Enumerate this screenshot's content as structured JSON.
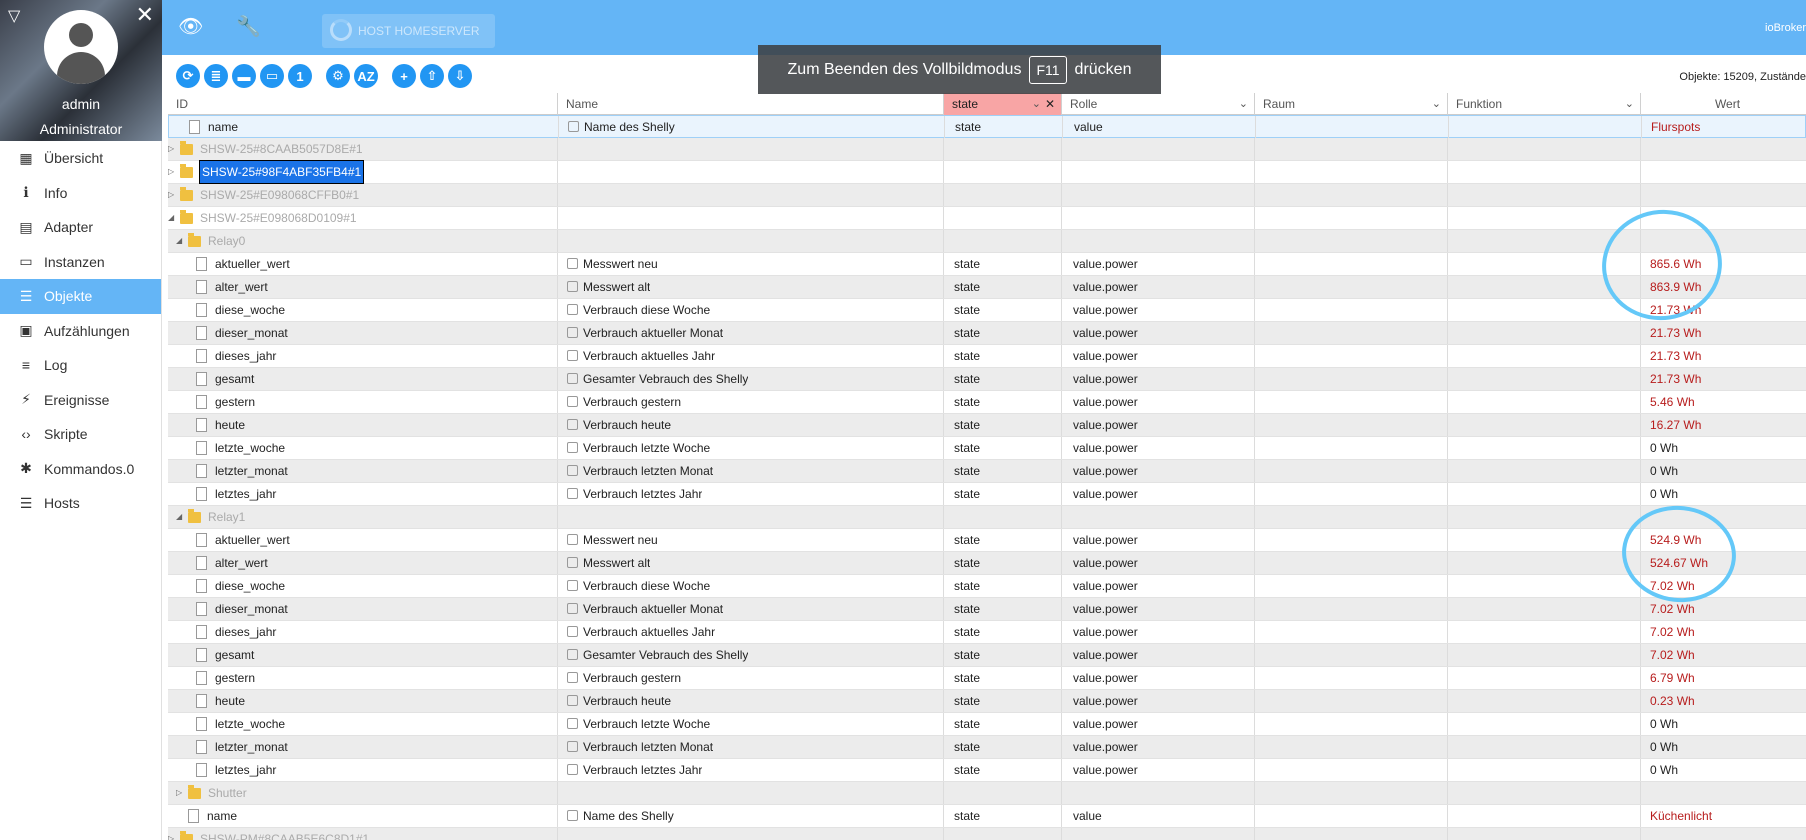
{
  "sidebar": {
    "username": "admin",
    "role": "Administrator",
    "items": [
      {
        "label": "Übersicht",
        "icon": "grid-icon",
        "glyph": "▦"
      },
      {
        "label": "Info",
        "icon": "info-icon",
        "glyph": "ℹ"
      },
      {
        "label": "Adapter",
        "icon": "store-icon",
        "glyph": "▤"
      },
      {
        "label": "Instanzen",
        "icon": "instances-icon",
        "glyph": "▭"
      },
      {
        "label": "Objekte",
        "icon": "list-icon",
        "glyph": "☰",
        "active": true
      },
      {
        "label": "Aufzählungen",
        "icon": "enum-icon",
        "glyph": "▣"
      },
      {
        "label": "Log",
        "icon": "log-icon",
        "glyph": "≡"
      },
      {
        "label": "Ereignisse",
        "icon": "bolt-icon",
        "glyph": "⚡"
      },
      {
        "label": "Skripte",
        "icon": "code-icon",
        "glyph": "‹›"
      },
      {
        "label": "Kommandos.0",
        "icon": "snowflake-icon",
        "glyph": "✱"
      },
      {
        "label": "Hosts",
        "icon": "hosts-icon",
        "glyph": "☰"
      }
    ]
  },
  "topbar": {
    "host_button": "HOST HOMESERVER",
    "brand": "ioBroker"
  },
  "overlay": {
    "before": "Zum Beenden des Vollbildmodus",
    "key": "F11",
    "after": "drücken"
  },
  "toolbar": {
    "object_count": "Objekte: 15209, Zustände"
  },
  "table": {
    "headers": {
      "id": "ID",
      "name": "Name",
      "type": "state",
      "role": "Rolle",
      "room": "Raum",
      "function": "Funktion",
      "value": "Wert"
    },
    "rows": [
      {
        "kind": "file",
        "level": 1,
        "id": "name",
        "name": "Name des Shelly",
        "type": "state",
        "role": "value",
        "value": "Flurspots",
        "sel": true
      },
      {
        "kind": "folder",
        "level": 0,
        "collapsed": true,
        "id": "SHSW-25#8CAAB5057D8E#1",
        "muted": true
      },
      {
        "kind": "folder",
        "level": 0,
        "collapsed": true,
        "id": "SHSW-25#98F4ABF35FB4#1",
        "highlight": true
      },
      {
        "kind": "folder",
        "level": 0,
        "collapsed": true,
        "id": "SHSW-25#E098068CFFB0#1",
        "muted": true
      },
      {
        "kind": "folder",
        "level": 0,
        "collapsed": false,
        "id": "SHSW-25#E098068D0109#1",
        "muted": true
      },
      {
        "kind": "folder",
        "level": 1,
        "collapsed": false,
        "id": "Relay0",
        "muted": true
      },
      {
        "kind": "file",
        "level": 2,
        "id": "aktueller_wert",
        "name": "Messwert neu",
        "type": "state",
        "role": "value.power",
        "value": "865.6 Wh"
      },
      {
        "kind": "file",
        "level": 2,
        "id": "alter_wert",
        "name": "Messwert alt",
        "type": "state",
        "role": "value.power",
        "value": "863.9 Wh"
      },
      {
        "kind": "file",
        "level": 2,
        "id": "diese_woche",
        "name": "Verbrauch diese Woche",
        "type": "state",
        "role": "value.power",
        "value": "21.73 Wh"
      },
      {
        "kind": "file",
        "level": 2,
        "id": "dieser_monat",
        "name": "Verbrauch aktueller Monat",
        "type": "state",
        "role": "value.power",
        "value": "21.73 Wh"
      },
      {
        "kind": "file",
        "level": 2,
        "id": "dieses_jahr",
        "name": "Verbrauch aktuelles Jahr",
        "type": "state",
        "role": "value.power",
        "value": "21.73 Wh"
      },
      {
        "kind": "file",
        "level": 2,
        "id": "gesamt",
        "name": "Gesamter Vebrauch des Shelly",
        "type": "state",
        "role": "value.power",
        "value": "21.73 Wh"
      },
      {
        "kind": "file",
        "level": 2,
        "id": "gestern",
        "name": "Verbrauch gestern",
        "type": "state",
        "role": "value.power",
        "value": "5.46 Wh"
      },
      {
        "kind": "file",
        "level": 2,
        "id": "heute",
        "name": "Verbrauch heute",
        "type": "state",
        "role": "value.power",
        "value": "16.27 Wh"
      },
      {
        "kind": "file",
        "level": 2,
        "id": "letzte_woche",
        "name": "Verbrauch letzte Woche",
        "type": "state",
        "role": "value.power",
        "value": "0 Wh",
        "zero": true
      },
      {
        "kind": "file",
        "level": 2,
        "id": "letzter_monat",
        "name": "Verbrauch letzten Monat",
        "type": "state",
        "role": "value.power",
        "value": "0 Wh",
        "zero": true
      },
      {
        "kind": "file",
        "level": 2,
        "id": "letztes_jahr",
        "name": "Verbrauch letztes Jahr",
        "type": "state",
        "role": "value.power",
        "value": "0 Wh",
        "zero": true
      },
      {
        "kind": "folder",
        "level": 1,
        "collapsed": false,
        "id": "Relay1",
        "muted": true
      },
      {
        "kind": "file",
        "level": 2,
        "id": "aktueller_wert",
        "name": "Messwert neu",
        "type": "state",
        "role": "value.power",
        "value": "524.9 Wh"
      },
      {
        "kind": "file",
        "level": 2,
        "id": "alter_wert",
        "name": "Messwert alt",
        "type": "state",
        "role": "value.power",
        "value": "524.67 Wh"
      },
      {
        "kind": "file",
        "level": 2,
        "id": "diese_woche",
        "name": "Verbrauch diese Woche",
        "type": "state",
        "role": "value.power",
        "value": "7.02 Wh"
      },
      {
        "kind": "file",
        "level": 2,
        "id": "dieser_monat",
        "name": "Verbrauch aktueller Monat",
        "type": "state",
        "role": "value.power",
        "value": "7.02 Wh"
      },
      {
        "kind": "file",
        "level": 2,
        "id": "dieses_jahr",
        "name": "Verbrauch aktuelles Jahr",
        "type": "state",
        "role": "value.power",
        "value": "7.02 Wh"
      },
      {
        "kind": "file",
        "level": 2,
        "id": "gesamt",
        "name": "Gesamter Vebrauch des Shelly",
        "type": "state",
        "role": "value.power",
        "value": "7.02 Wh"
      },
      {
        "kind": "file",
        "level": 2,
        "id": "gestern",
        "name": "Verbrauch gestern",
        "type": "state",
        "role": "value.power",
        "value": "6.79 Wh"
      },
      {
        "kind": "file",
        "level": 2,
        "id": "heute",
        "name": "Verbrauch heute",
        "type": "state",
        "role": "value.power",
        "value": "0.23 Wh"
      },
      {
        "kind": "file",
        "level": 2,
        "id": "letzte_woche",
        "name": "Verbrauch letzte Woche",
        "type": "state",
        "role": "value.power",
        "value": "0 Wh",
        "zero": true
      },
      {
        "kind": "file",
        "level": 2,
        "id": "letzter_monat",
        "name": "Verbrauch letzten Monat",
        "type": "state",
        "role": "value.power",
        "value": "0 Wh",
        "zero": true
      },
      {
        "kind": "file",
        "level": 2,
        "id": "letztes_jahr",
        "name": "Verbrauch letztes Jahr",
        "type": "state",
        "role": "value.power",
        "value": "0 Wh",
        "zero": true
      },
      {
        "kind": "folder",
        "level": 1,
        "collapsed": true,
        "id": "Shutter",
        "muted": true
      },
      {
        "kind": "file",
        "level": 1,
        "id": "name",
        "name": "Name des Shelly",
        "type": "state",
        "role": "value",
        "value": "Küchenlicht"
      },
      {
        "kind": "folder",
        "level": 0,
        "collapsed": true,
        "id": "SHSW-PM#8CAAB5E6C8D1#1",
        "muted": true
      }
    ]
  },
  "colors": {
    "accent": "#64b5f6",
    "button": "#2196f3",
    "value_red": "#b71c1c",
    "circle": "#64c8f8",
    "filter_bg": "#f8a5a5"
  }
}
